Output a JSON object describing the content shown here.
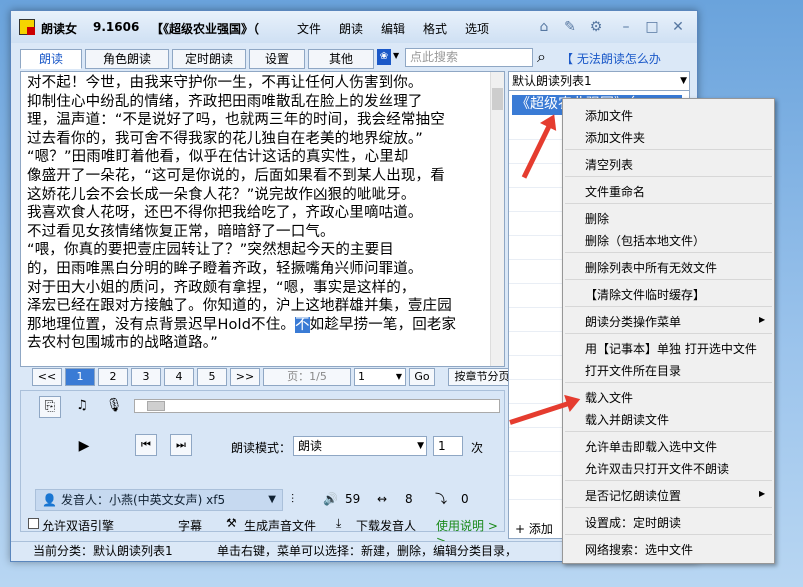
{
  "title": {
    "app": "朗读女",
    "version": "9.1606",
    "doc": "【《超级农业强国》（"
  },
  "menubar": [
    "文件",
    "朗读",
    "编辑",
    "格式",
    "选项"
  ],
  "tabs": [
    "朗读",
    "角色朗读",
    "定时朗读",
    "设置",
    "其他"
  ],
  "search": {
    "placeholder": "点此搜索"
  },
  "help_link": "【 无法朗读怎么办",
  "text_lines": [
    "    对不起！今世，由我来守护你一生，不再让任何人伤害到你。",
    "    抑制住心中纷乱的情绪，齐政把田雨唯散乱在脸上的发丝理了",
    "理，温声道：“不是说好了吗，也就两三年的时间，我会经常抽空",
    "过去看你的，我可舍不得我家的花儿独自在老美的地界绽放。”",
    "    “嗯？”田雨唯盯着他看，似乎在估计这话的真实性，心里却",
    "像盛开了一朵花，“这可是你说的，后面如果看不到某人出现，看",
    "这娇花儿会不会长成一朵食人花？”说完故作凶狠的呲呲牙。",
    "    我喜欢食人花呀，还巴不得你把我给吃了，齐政心里嘀咕道。",
    "不过看见女孩情绪恢复正常，暗暗舒了一口气。",
    "    “喂，你真的要把壹庄园转让了？”突然想起今天的主要目",
    "的，田雨唯黑白分明的眸子瞪着齐政，轻撅嘴角兴师问罪道。",
    "    对于田大小姐的质问，齐政颇有拿捏，“嗯，事实是这样的，",
    "泽宏已经在跟对方接触了。你知道的，沪上这地群雄并集，壹庄园",
    "那地理位置，没有点背景迟早Hold不住。"
  ],
  "text_line_13_selected": "不",
  "text_line_13_tail": "如趁早捞一笔，回老家",
  "text_line_14": "去农村包围城市的战略道路。”",
  "pager": {
    "prev": "<<",
    "pages": [
      "1",
      "2",
      "3",
      "4",
      "5"
    ],
    "next": ">>",
    "page_info": "页：1/5",
    "page_select": "1",
    "go": "Go",
    "split_mode": "按章节分页"
  },
  "read_mode": {
    "label": "朗读模式：",
    "value": "朗读",
    "count": "1",
    "unit": "次"
  },
  "voice": {
    "label": "发音人：小燕(中英文女声) xf5",
    "volume": "59",
    "speed": "8",
    "pitch": "0"
  },
  "bottom": {
    "dual_engine": "允许双语引擎",
    "subtitle": "字幕",
    "gen_audio": "生成声音文件",
    "download_voice": "下载发音人",
    "usage": "使用说明 > >"
  },
  "status": {
    "category": "当前分类：默认朗读列表1",
    "hint": "单击右键，菜单可以选择：新建，删除，编辑分类目录，"
  },
  "playlist": {
    "selector": "默认朗读列表1",
    "item": "《超级农业强国》（",
    "add_button": "+ 添加"
  },
  "context_menu": [
    "添加文件",
    "添加文件夹",
    "清空列表",
    "文件重命名",
    "删除",
    "删除（包括本地文件）",
    "删除列表中所有无效文件",
    "【清除文件临时缓存】",
    "朗读分类操作菜单",
    "用【记事本】单独 打开选中文件",
    "打开文件所在目录",
    "载入文件",
    "载入并朗读文件",
    "允许单击即载入选中文件",
    "允许双击只打开文件不朗读",
    "是否记忆朗读位置",
    "设置成：定时朗读",
    "网络搜索：选中文件"
  ]
}
